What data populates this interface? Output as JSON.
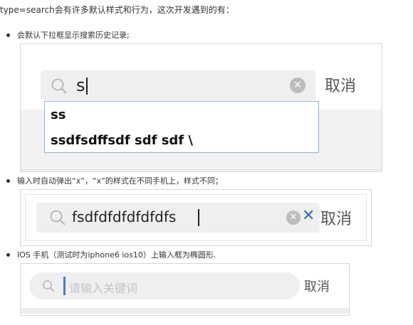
{
  "intro_text": "type=search会有许多默认样式和行为，这次开发遇到的有：",
  "sections": [
    {
      "bullet": "会默认下拉框显示搜索历史记录;",
      "search": {
        "value": "s",
        "cancel_label": "取消",
        "history": [
          "ss",
          "ssdfsdffsdf sdf sdf \\"
        ]
      }
    },
    {
      "bullet": "输入时自动弹出“x”，“x”的样式在不同手机上，样式不同；",
      "search": {
        "value": "fsdfdfdfdfdfdfs",
        "cancel_label": "取消"
      }
    },
    {
      "bullet": "IOS 手机（测试时为iphone6 ios10）上输入框为椭圆形.",
      "search": {
        "placeholder": "请输入关键词",
        "cancel_label": "取消"
      }
    }
  ],
  "colors": {
    "pill_bg": "#efeff1",
    "clear_icon_gray": "#bdbdbd",
    "clear_icon_blue": "#2f6fb6",
    "caret_blue": "#4a78d8",
    "border": "#d6d6d6"
  }
}
